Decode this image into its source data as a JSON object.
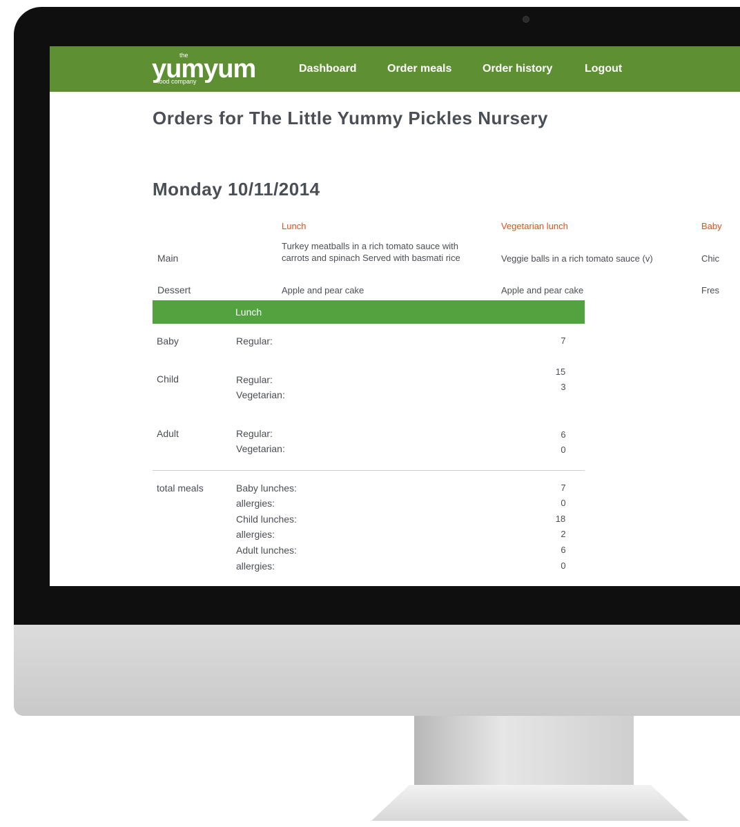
{
  "nav": {
    "logo_the": "the",
    "logo_main": "yumyum",
    "logo_sub": "food company",
    "items": [
      "Dashboard",
      "Order meals",
      "Order history",
      "Logout"
    ]
  },
  "page": {
    "title": "Orders for The Little Yummy Pickles Nursery",
    "date_heading": "Monday 10/11/2014"
  },
  "menu": {
    "columns": [
      "Lunch",
      "Vegetarian lunch",
      "Baby"
    ],
    "rows": [
      {
        "label": "Main",
        "values": [
          "Turkey meatballs in a rich tomato sauce with carrots and spinach Served with basmati rice",
          "Veggie balls in a rich tomato sauce (v)",
          "Chic"
        ]
      },
      {
        "label": "Dessert",
        "values": [
          "Apple and pear cake",
          "Apple and pear cake",
          "Fres"
        ]
      }
    ]
  },
  "orders": {
    "section_header": "Lunch",
    "groups": [
      {
        "label": "Baby",
        "types": [
          "Regular:"
        ],
        "values": [
          "7"
        ]
      },
      {
        "label": "Child",
        "types": [
          "Regular:",
          "Vegetarian:"
        ],
        "values": [
          "15",
          "3"
        ]
      },
      {
        "label": "Adult",
        "types": [
          "Regular:",
          "Vegetarian:"
        ],
        "values": [
          "6",
          "0"
        ]
      }
    ],
    "totals_label": "total meals",
    "totals": [
      {
        "label": "Baby lunches:",
        "value": "7"
      },
      {
        "label": "allergies:",
        "value": "0"
      },
      {
        "label": "Child lunches:",
        "value": "18"
      },
      {
        "label": "allergies:",
        "value": "2"
      },
      {
        "label": "Adult lunches:",
        "value": "6"
      },
      {
        "label": "allergies:",
        "value": "0"
      }
    ]
  },
  "colors": {
    "navbar": "#5f8f33",
    "accent_orange": "#e0501e",
    "lunch_bar": "#52a240",
    "text": "#4a4e55"
  }
}
